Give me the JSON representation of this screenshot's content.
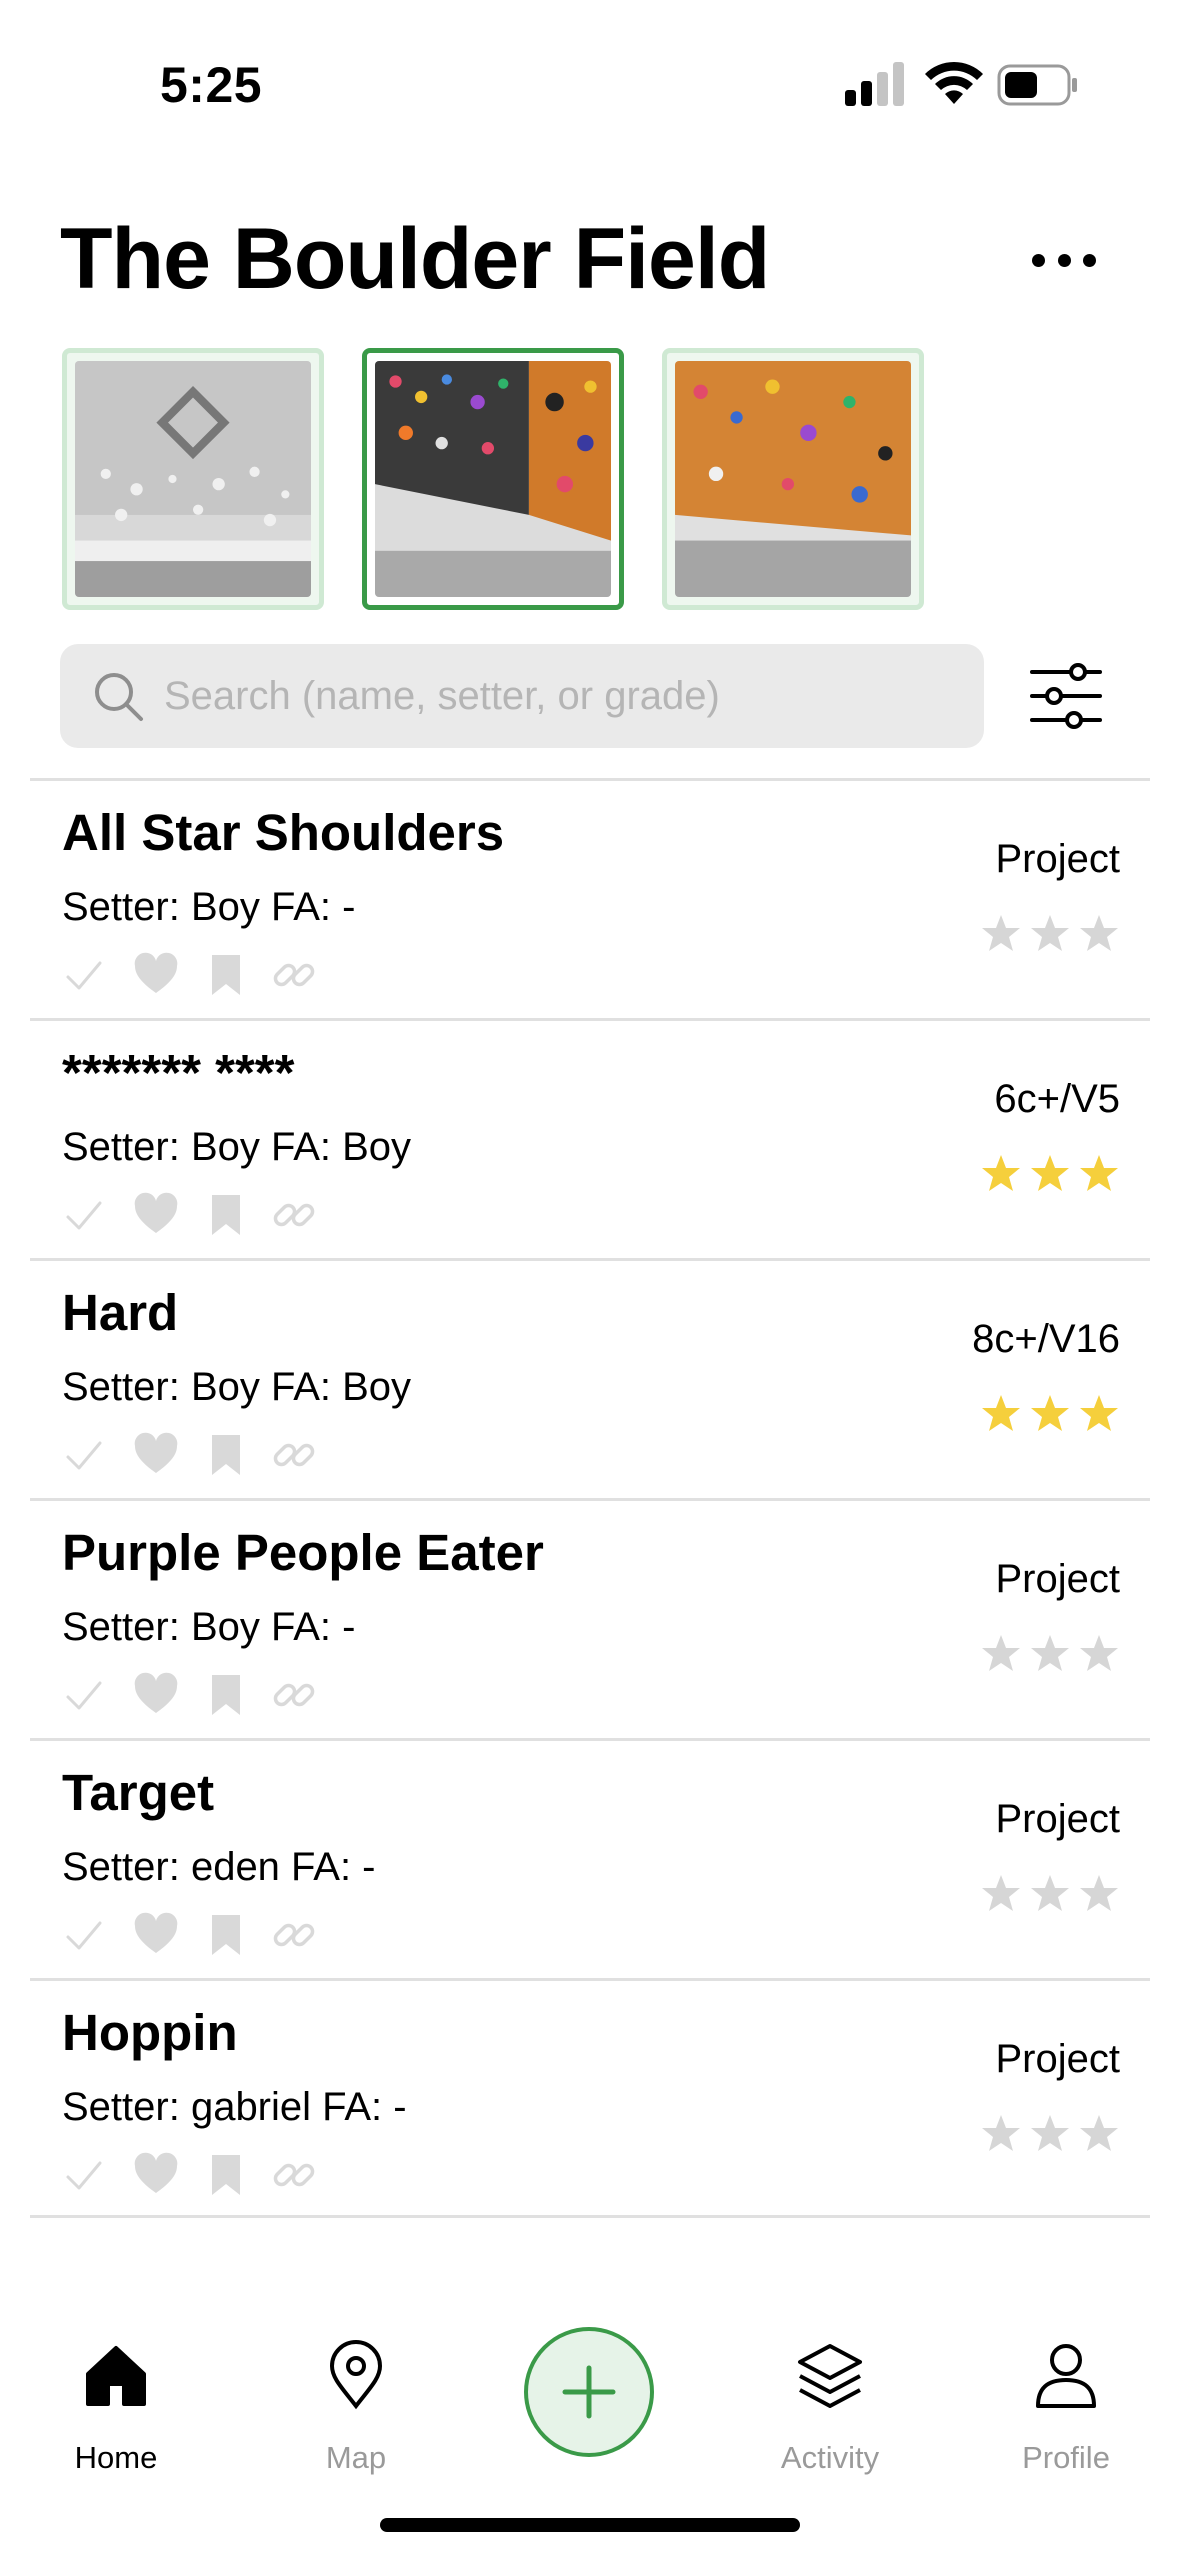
{
  "status_bar": {
    "time": "5:25"
  },
  "header": {
    "title": "The Boulder Field"
  },
  "thumbnails": [
    {
      "selected": false,
      "palette": "grey"
    },
    {
      "selected": true,
      "palette": "colorful"
    },
    {
      "selected": false,
      "palette": "orange"
    }
  ],
  "search": {
    "placeholder": "Search (name, setter, or grade)",
    "value": ""
  },
  "routes": [
    {
      "name": "All Star Shoulders",
      "setter": "Setter: Boy FA: -",
      "grade": "Project",
      "stars": 0
    },
    {
      "name": "******* ****",
      "setter": "Setter: Boy FA: Boy",
      "grade": "6c+/V5",
      "stars": 3
    },
    {
      "name": "Hard",
      "setter": "Setter: Boy FA: Boy",
      "grade": "8c+/V16",
      "stars": 3
    },
    {
      "name": "Purple People Eater",
      "setter": "Setter: Boy FA: -",
      "grade": "Project",
      "stars": 0
    },
    {
      "name": "Target",
      "setter": "Setter: eden FA: -",
      "grade": "Project",
      "stars": 0
    },
    {
      "name": "Hoppin",
      "setter": "Setter: gabriel FA: -",
      "grade": "Project",
      "stars": 0
    }
  ],
  "tabs": [
    {
      "label": "Home",
      "icon": "home-icon",
      "active": true
    },
    {
      "label": "Map",
      "icon": "map-pin-icon",
      "active": false
    },
    {
      "label": "Activity",
      "icon": "layers-icon",
      "active": false
    },
    {
      "label": "Profile",
      "icon": "person-icon",
      "active": false
    }
  ],
  "colors": {
    "accent": "#3a9a48",
    "accent_light": "#e6f3e8",
    "star_filled": "#f5cf3c",
    "star_empty": "#d6d6d6",
    "icon_muted": "#d9d9d9"
  }
}
